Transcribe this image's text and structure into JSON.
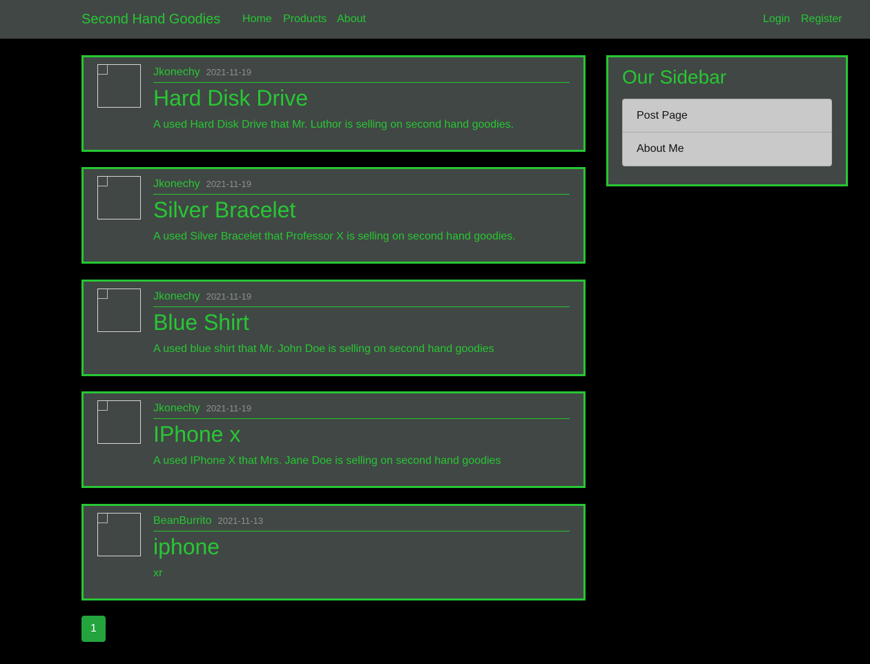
{
  "header": {
    "brand": "Second Hand Goodies",
    "nav": [
      "Home",
      "Products",
      "About"
    ],
    "auth": [
      "Login",
      "Register"
    ]
  },
  "posts": [
    {
      "author": "Jkonechy",
      "date": "2021-11-19",
      "title": "Hard Disk Drive",
      "description": "A used Hard Disk Drive that Mr. Luthor is selling on second hand goodies."
    },
    {
      "author": "Jkonechy",
      "date": "2021-11-19",
      "title": "Silver Bracelet",
      "description": "A used Silver Bracelet that Professor X is selling on second hand goodies."
    },
    {
      "author": "Jkonechy",
      "date": "2021-11-19",
      "title": "Blue Shirt",
      "description": "A used blue shirt that Mr. John Doe is selling on second hand goodies"
    },
    {
      "author": "Jkonechy",
      "date": "2021-11-19",
      "title": "IPhone x",
      "description": "A used IPhone X that Mrs. Jane Doe is selling on second hand goodies"
    },
    {
      "author": "BeanBurrito",
      "date": "2021-11-13",
      "title": "iphone",
      "description": "xr"
    }
  ],
  "pagination": {
    "current": "1"
  },
  "sidebar": {
    "title": "Our Sidebar",
    "items": [
      "Post Page",
      "About Me"
    ]
  },
  "colors": {
    "accent": "#27c733",
    "background": "#000000",
    "panel": "#414745",
    "page_button": "#23a43d"
  }
}
